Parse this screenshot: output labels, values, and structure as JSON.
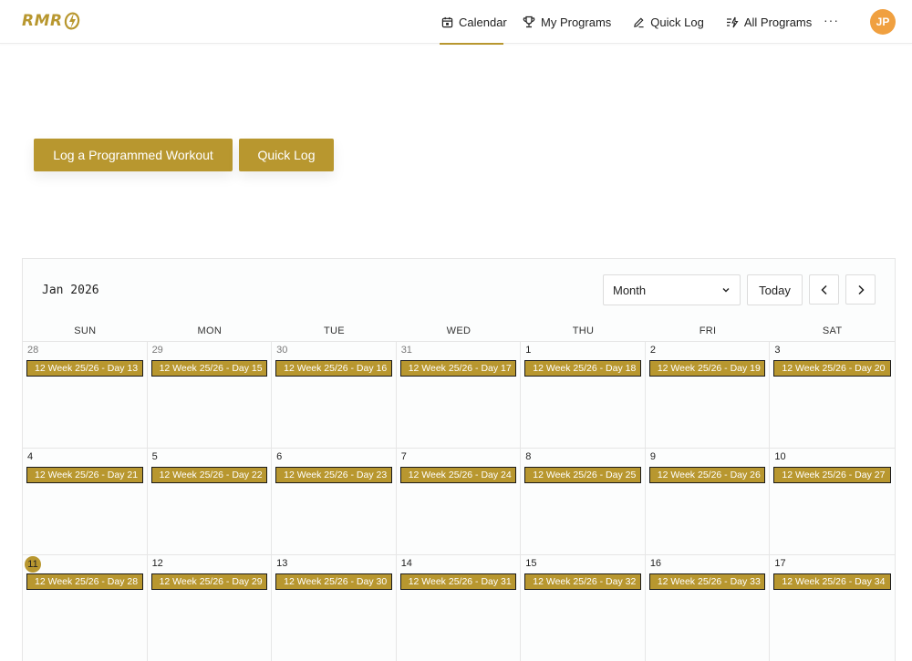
{
  "brand": {
    "logo_text": "RMR",
    "accent": "#b8972f"
  },
  "nav": {
    "items": [
      {
        "label": "Calendar",
        "icon": "calendar-icon",
        "active": true
      },
      {
        "label": "My Programs",
        "icon": "trophy-icon",
        "active": false
      },
      {
        "label": "Quick Log",
        "icon": "pencil-icon",
        "active": false
      },
      {
        "label": "All Programs",
        "icon": "list-bolt-icon",
        "active": false
      }
    ],
    "more_label": "···",
    "avatar_initials": "JP"
  },
  "actions": {
    "programmed_label": "Log a Programmed Workout",
    "quick_label": "Quick Log"
  },
  "calendar": {
    "title": "Jan 2026",
    "view_selected": "Month",
    "today_label": "Today",
    "weekdays": [
      "SUN",
      "MON",
      "TUE",
      "WED",
      "THU",
      "FRI",
      "SAT"
    ],
    "weeks": [
      [
        {
          "num": "28",
          "muted": true,
          "event": "12 Week 25/26 - Day 13"
        },
        {
          "num": "29",
          "muted": true,
          "event": "12 Week 25/26 - Day 15"
        },
        {
          "num": "30",
          "muted": true,
          "event": "12 Week 25/26 - Day 16"
        },
        {
          "num": "31",
          "muted": true,
          "event": "12 Week 25/26 - Day 17"
        },
        {
          "num": "1",
          "muted": false,
          "event": "12 Week 25/26 - Day 18"
        },
        {
          "num": "2",
          "muted": false,
          "event": "12 Week 25/26 - Day 19"
        },
        {
          "num": "3",
          "muted": false,
          "event": "12 Week 25/26 - Day 20"
        }
      ],
      [
        {
          "num": "4",
          "muted": false,
          "event": "12 Week 25/26 - Day 21"
        },
        {
          "num": "5",
          "muted": false,
          "event": "12 Week 25/26 - Day 22"
        },
        {
          "num": "6",
          "muted": false,
          "event": "12 Week 25/26 - Day 23"
        },
        {
          "num": "7",
          "muted": false,
          "event": "12 Week 25/26 - Day 24"
        },
        {
          "num": "8",
          "muted": false,
          "event": "12 Week 25/26 - Day 25"
        },
        {
          "num": "9",
          "muted": false,
          "event": "12 Week 25/26 - Day 26"
        },
        {
          "num": "10",
          "muted": false,
          "event": "12 Week 25/26 - Day 27"
        }
      ],
      [
        {
          "num": "11",
          "muted": false,
          "today": true,
          "event": "12 Week 25/26 - Day 28"
        },
        {
          "num": "12",
          "muted": false,
          "event": "12 Week 25/26 - Day 29"
        },
        {
          "num": "13",
          "muted": false,
          "event": "12 Week 25/26 - Day 30"
        },
        {
          "num": "14",
          "muted": false,
          "event": "12 Week 25/26 - Day 31"
        },
        {
          "num": "15",
          "muted": false,
          "event": "12 Week 25/26 - Day 32"
        },
        {
          "num": "16",
          "muted": false,
          "event": "12 Week 25/26 - Day 33"
        },
        {
          "num": "17",
          "muted": false,
          "event": "12 Week 25/26 - Day 34"
        }
      ]
    ]
  }
}
